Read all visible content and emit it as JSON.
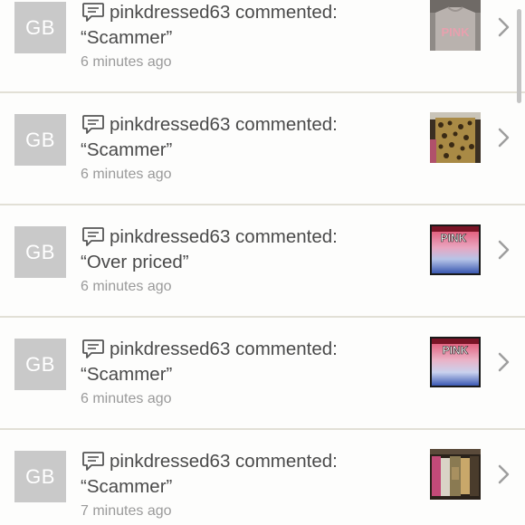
{
  "notifications": [
    {
      "avatar_initials": "GB",
      "username": "pinkdressed63",
      "action": "commented:",
      "comment": "“Scammer”",
      "time_ago": "6 minutes ago",
      "thumb": "grey-pink-shirt"
    },
    {
      "avatar_initials": "GB",
      "username": "pinkdressed63",
      "action": "commented:",
      "comment": "“Scammer”",
      "time_ago": "6 minutes ago",
      "thumb": "leopard-rack"
    },
    {
      "avatar_initials": "GB",
      "username": "pinkdressed63",
      "action": "commented:",
      "comment": "“Over priced”",
      "time_ago": "6 minutes ago",
      "thumb": "pink-logo-tee",
      "thumb_text": "PINK"
    },
    {
      "avatar_initials": "GB",
      "username": "pinkdressed63",
      "action": "commented:",
      "comment": "“Scammer”",
      "time_ago": "6 minutes ago",
      "thumb": "pink-logo-tee",
      "thumb_text": "PINK"
    },
    {
      "avatar_initials": "GB",
      "username": "pinkdressed63",
      "action": "commented:",
      "comment": "“Scammer”",
      "time_ago": "7 minutes ago",
      "thumb": "clothing-rack"
    }
  ],
  "icons": {
    "comment": "speech-bubble-icon",
    "row_arrow": "chevron-right-icon"
  },
  "colors": {
    "background": "#fdfdfc",
    "divider": "#e2e0d6",
    "avatar_bg": "#c9c9c9",
    "primary_text": "#4a4a4a",
    "secondary_text": "#9a9a9a"
  }
}
